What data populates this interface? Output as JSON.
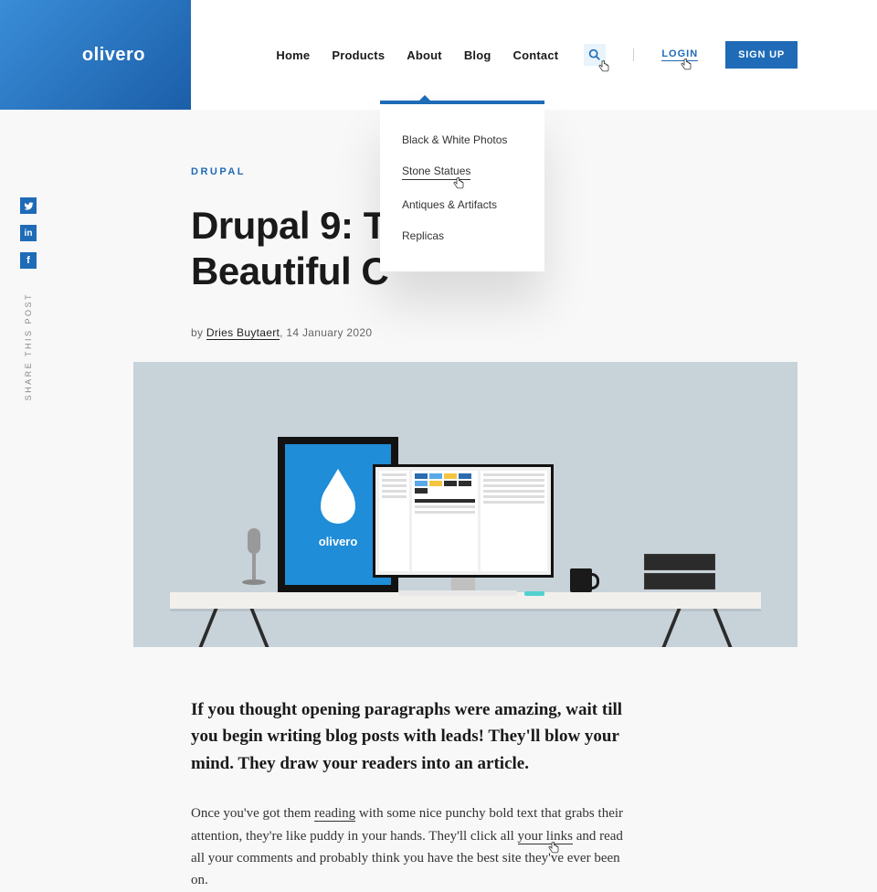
{
  "brand": {
    "name": "olivero"
  },
  "nav": {
    "items": [
      "Home",
      "Products",
      "About",
      "Blog",
      "Contact"
    ],
    "login": "LOGIN",
    "signup": "SIGN UP"
  },
  "dropdown": {
    "items": [
      "Black & White Photos",
      "Stone Statues",
      "Antiques & Artifacts",
      "Replicas"
    ]
  },
  "share": {
    "label": "SHARE THIS POST"
  },
  "article": {
    "category": "DRUPAL",
    "title_line1": "Drupal 9: T",
    "title_line2": "Beautiful C",
    "byline_prefix": "by ",
    "author": "Dries Buytaert",
    "byline_suffix": ", 14 January 2020",
    "hero_brand": "olivero",
    "lead": "If you thought opening paragraphs were amazing, wait till you begin writing blog posts with leads! They'll blow your mind. They draw your readers into an article.",
    "para_part1": "Once you've got them ",
    "para_link1": "reading",
    "para_part2": " with some nice punchy bold text that grabs their attention, they're like puddy in your hands. They'll click all ",
    "para_link2": "your links",
    "para_part3": " and read all your comments and probably think you have the best site they've ever been on."
  }
}
